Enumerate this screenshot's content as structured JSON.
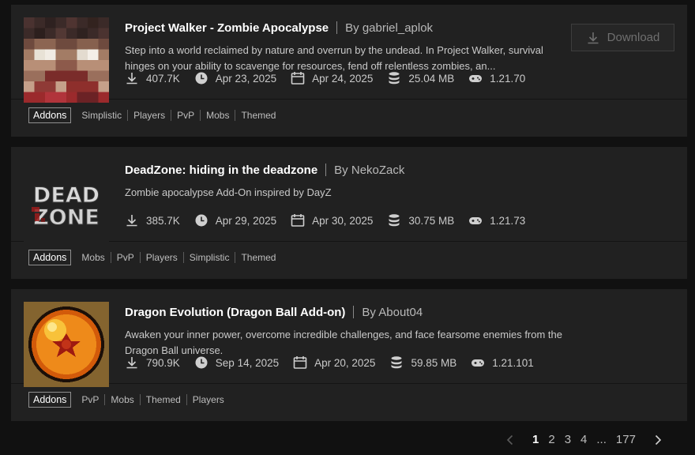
{
  "items": [
    {
      "title": "Project Walker - Zombie Apocalypse",
      "by_prefix": "By",
      "author": "gabriel_aplok",
      "description": "Step into a world reclaimed by nature and overrun by the undead. In Project Walker, survival hinges on your ability to scavenge for resources, fend off relentless zombies, an...",
      "downloads": "407.7K",
      "created": "Apr 23, 2025",
      "updated": "Apr 24, 2025",
      "size": "25.04 MB",
      "version": "1.21.70",
      "category": "Addons",
      "tags": [
        "Simplistic",
        "Players",
        "PvP",
        "Mobs",
        "Themed"
      ],
      "download_label": "Download"
    },
    {
      "title": "DeadZone: hiding in the deadzone",
      "by_prefix": "By",
      "author": "NekoZack",
      "description": "Zombie apocalypse Add-On inspired by DayZ",
      "downloads": "385.7K",
      "created": "Apr 29, 2025",
      "updated": "Apr 30, 2025",
      "size": "30.75 MB",
      "version": "1.21.73",
      "category": "Addons",
      "tags": [
        "Mobs",
        "PvP",
        "Players",
        "Simplistic",
        "Themed"
      ],
      "thumb_text": [
        "DEAD",
        "ZONE"
      ]
    },
    {
      "title": "Dragon Evolution (Dragon Ball Add-on)",
      "by_prefix": "By",
      "author": "About04",
      "description": "Awaken your inner power, overcome incredible challenges, and face fearsome enemies from the Dragon Ball universe.",
      "downloads": "790.9K",
      "created": "Sep 14, 2025",
      "updated": "Apr 20, 2025",
      "size": "59.85 MB",
      "version": "1.21.101",
      "category": "Addons",
      "tags": [
        "PvP",
        "Mobs",
        "Themed",
        "Players"
      ]
    }
  ],
  "pagination": {
    "pages": [
      "1",
      "2",
      "3",
      "4"
    ],
    "ellipsis": "...",
    "last": "177",
    "current": "1"
  },
  "colors": {
    "background": "#111111",
    "card": "#212121",
    "title": "#ffffff",
    "muted": "#c9c9c9"
  },
  "icons": {
    "downloads": "download-icon",
    "created": "clock-icon",
    "updated": "calendar-icon",
    "size": "database-icon",
    "version": "gamepad-icon"
  }
}
